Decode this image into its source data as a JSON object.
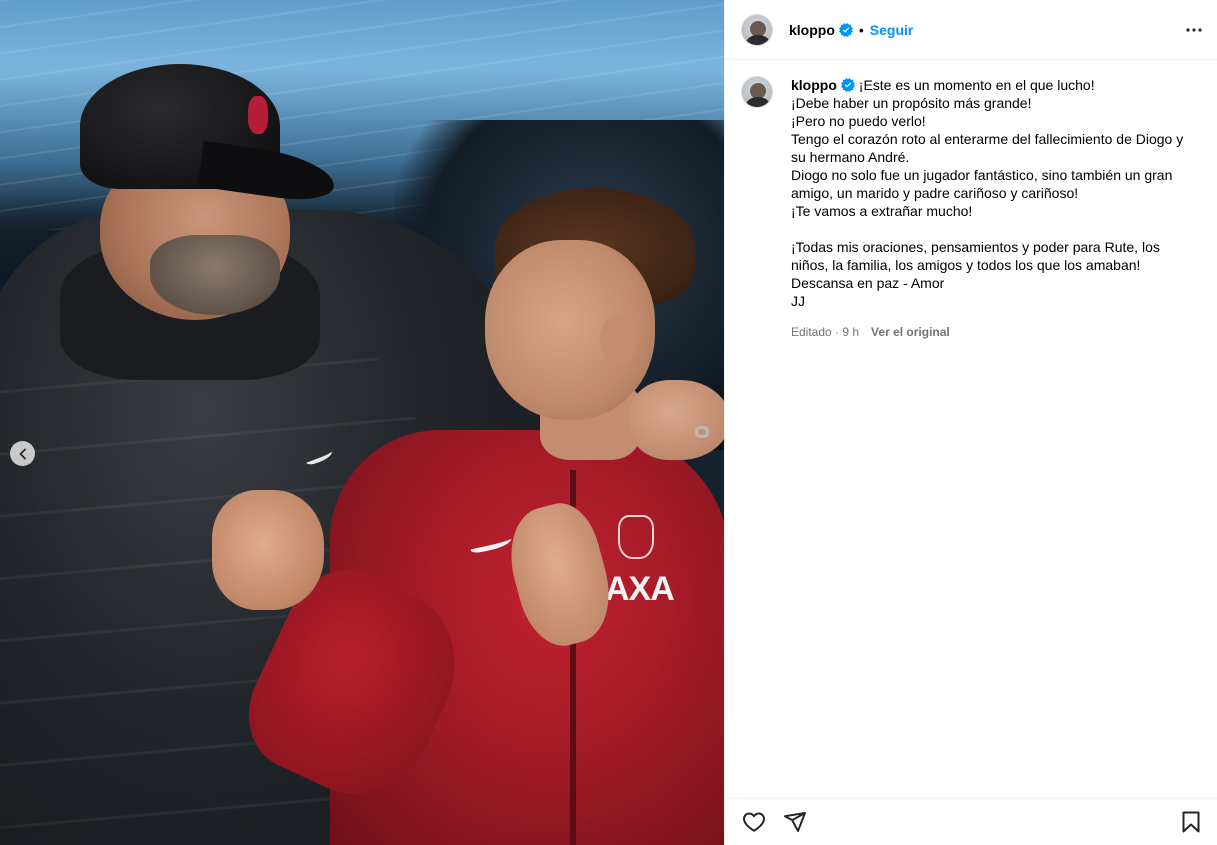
{
  "post": {
    "username": "kloppo",
    "verified": true,
    "separator": "•",
    "follow_label": "Seguir",
    "more_icon": "more-horizontal-icon",
    "caption": "¡Este es un momento en el que lucho!\n¡Debe haber un propósito más grande!\n¡Pero no puedo verlo!\nTengo el corazón roto al enterarme del fallecimiento de Diogo y su hermano André.\nDiogo no solo fue un jugador fantástico, sino también un gran amigo, un marido y padre cariñoso y cariñoso!\n¡Te vamos a extrañar mucho!\n\n¡Todas mis oraciones, pensamientos y poder para Rute, los niños, la familia, los amigos y todos los que los amaban!\nDescansa en paz - Amor\nJJ",
    "edited_time": "Editado · 9 h",
    "see_original_label": "Ver el original"
  },
  "media": {
    "sponsor_text": "AXA",
    "prev_icon": "chevron-left-icon"
  },
  "actions": {
    "like_icon": "heart-icon",
    "share_icon": "send-icon",
    "save_icon": "bookmark-icon"
  },
  "colors": {
    "accent": "#0095f6",
    "verified": "#0095f6",
    "muted": "#737373",
    "border": "#efefef"
  }
}
